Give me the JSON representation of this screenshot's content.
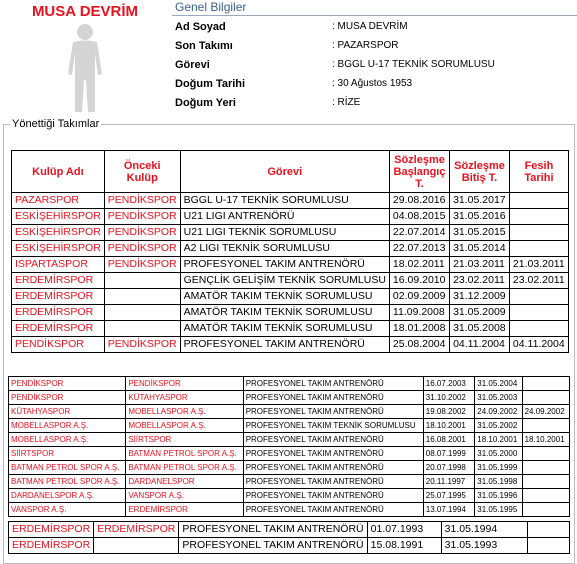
{
  "profile": {
    "name": "MUSA DEVRİM",
    "section_title": "Genel Bilgiler",
    "fields": [
      {
        "label": "Ad Soyad",
        "value": ": MUSA DEVRİM"
      },
      {
        "label": "Son Takımı",
        "value": ": PAZARSPOR"
      },
      {
        "label": "Görevi",
        "value": ": BGGL U-17 TEKNİK SORUMLUSU"
      },
      {
        "label": "Doğum Tarihi",
        "value": ": 30 Ağustos 1953"
      },
      {
        "label": "Doğum Yeri",
        "value": ": RİZE"
      }
    ]
  },
  "teams": {
    "legend": "Yönettiği Takımlar",
    "headers": [
      "Kulüp Adı",
      "Önceki Kulüp",
      "Görevi",
      "Sözleşme Başlangıç T.",
      "Sözleşme Bitiş T.",
      "Fesih Tarihi"
    ],
    "rows": [
      [
        "PAZARSPOR",
        "PENDİKSPOR",
        "BGGL U-17 TEKNİK SORUMLUSU",
        "29.08.2016",
        "31.05.2017",
        ""
      ],
      [
        "ESKİŞEHİRSPOR",
        "PENDİKSPOR",
        "U21 LIGI ANTRENÖRÜ",
        "04.08.2015",
        "31.05.2016",
        ""
      ],
      [
        "ESKİŞEHİRSPOR",
        "PENDİKSPOR",
        "U21 LIGI TEKNİK SORUMLUSU",
        "22.07.2014",
        "31.05.2015",
        ""
      ],
      [
        "ESKİŞEHİRSPOR",
        "PENDİKSPOR",
        "A2 LIGI TEKNİK SORUMLUSU",
        "22.07.2013",
        "31.05.2014",
        ""
      ],
      [
        "ISPARTASPOR",
        "PENDİKSPOR",
        "PROFESYONEL TAKIM ANTRENÖRÜ",
        "18.02.2011",
        "21.03.2011",
        "21.03.2011"
      ],
      [
        "ERDEMİRSPOR",
        "",
        "GENÇLİK GELİŞİM TEKNİK SORUMLUSU",
        "16.09.2010",
        "23.02.2011",
        "23.02.2011"
      ],
      [
        "ERDEMİRSPOR",
        "",
        "AMATÖR TAKIM TEKNİK SORUMLUSU",
        "02.09.2009",
        "31.12.2009",
        ""
      ],
      [
        "ERDEMİRSPOR",
        "",
        "AMATÖR TAKIM TEKNİK SORUMLUSU",
        "11.09.2008",
        "31.05.2009",
        ""
      ],
      [
        "ERDEMİRSPOR",
        "",
        "AMATÖR TAKIM TEKNİK SORUMLUSU",
        "18.01.2008",
        "31.05.2008",
        ""
      ],
      [
        "PENDİKSPOR",
        "PENDİKSPOR",
        "PROFESYONEL TAKIM ANTRENÖRÜ",
        "25.08.2004",
        "04.11.2004",
        "04.11.2004"
      ]
    ],
    "old_rows": [
      [
        "PENDİKSPOR",
        "PENDİKSPOR",
        "PROFESYONEL TAKIM ANTRENÖRÜ",
        "16.07.2003",
        "31.05.2004",
        ""
      ],
      [
        "PENDİKSPOR",
        "KÜTAHYASPOR",
        "PROFESYONEL TAKIM ANTRENÖRÜ",
        "31.10.2002",
        "31.05.2003",
        ""
      ],
      [
        "KÜTAHYASPOR",
        "MOBELLASPOR A.Ş.",
        "PROFESYONEL TAKIM ANTRENÖRÜ",
        "19.08.2002",
        "24.09.2002",
        "24.09.2002"
      ],
      [
        "MOBELLASPOR A.Ş.",
        "MOBELLASPOR A.Ş.",
        "PROFESYONEL TAKIM TEKNİK SORUMLUSU",
        "18.10.2001",
        "31.05.2002",
        ""
      ],
      [
        "MOBELLASPOR A.Ş.",
        "SİİRTSPOR",
        "PROFESYONEL TAKIM ANTRENÖRÜ",
        "16.08.2001",
        "18.10.2001",
        "18.10.2001"
      ],
      [
        "SİİRTSPOR",
        "BATMAN PETROL SPOR A.Ş.",
        "PROFESYONEL TAKIM ANTRENÖRÜ",
        "08.07.1999",
        "31.05.2000",
        ""
      ],
      [
        "BATMAN PETROL SPOR A.Ş.",
        "BATMAN PETROL SPOR A.Ş.",
        "PROFESYONEL TAKIM ANTRENÖRÜ",
        "20.07.1998",
        "31.05.1999",
        ""
      ],
      [
        "BATMAN PETROL SPOR A.Ş.",
        "DARDANELSPOR",
        "PROFESYONEL TAKIM ANTRENÖRÜ",
        "20.11.1997",
        "31.05.1998",
        ""
      ],
      [
        "DARDANELSPOR A.Ş.",
        "VANSPOR A.Ş.",
        "PROFESYONEL TAKIM ANTRENÖRÜ",
        "25.07.1995",
        "31.05.1996",
        ""
      ],
      [
        "VANSPOR A.Ş.",
        "ERDEMİRSPOR",
        "PROFESYONEL TAKIM ANTRENÖRÜ",
        "13.07.1994",
        "31.05.1995",
        ""
      ]
    ],
    "bottom_rows": [
      [
        "ERDEMİRSPOR",
        "ERDEMİRSPOR",
        "PROFESYONEL TAKIM ANTRENÖRÜ",
        "01.07.1993",
        "31.05.1994",
        ""
      ],
      [
        "ERDEMİRSPOR",
        "",
        "PROFESYONEL TAKIM ANTRENÖRÜ",
        "15.08.1991",
        "31.05.1993",
        ""
      ]
    ]
  }
}
